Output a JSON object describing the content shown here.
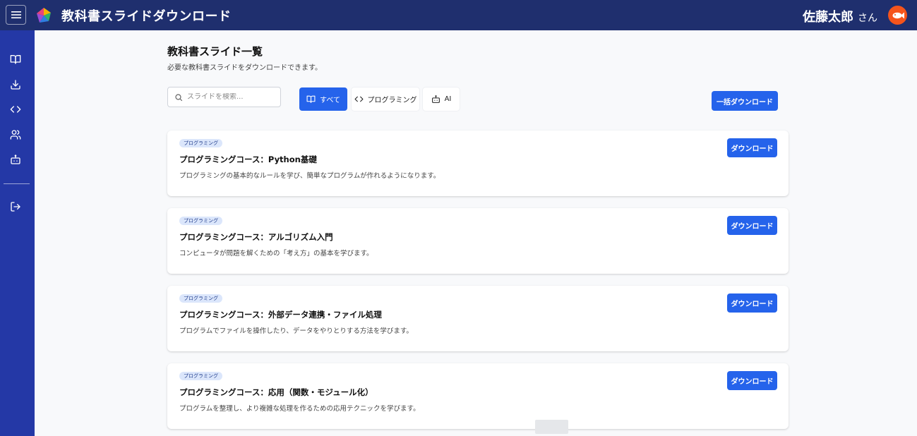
{
  "header": {
    "app_title": "教科書スライドダウンロード",
    "user_name": "佐藤太郎",
    "user_suffix": "さん",
    "menu_icon": "hamburger-menu-icon",
    "logo_icon": "gem-logo-icon",
    "avatar_icon": "fish-avatar-icon"
  },
  "sidebar": {
    "items": [
      {
        "icon": "book-icon",
        "label": "教科書"
      },
      {
        "icon": "download-icon",
        "label": "ダウンロード"
      },
      {
        "icon": "code-icon",
        "label": "プログラミング"
      },
      {
        "icon": "users-icon",
        "label": "ユーザー"
      },
      {
        "icon": "robot-icon",
        "label": "AI"
      }
    ],
    "logout_icon": "logout-icon"
  },
  "page": {
    "title": "教科書スライド一覧",
    "subtitle": "必要な教科書スライドをダウンロードできます。"
  },
  "search": {
    "placeholder": "スライドを検索...",
    "value": ""
  },
  "filters": [
    {
      "label": "すべて",
      "icon": "book-icon",
      "active": true
    },
    {
      "label": "プログラミング",
      "icon": "code-icon",
      "active": false
    },
    {
      "label": "AI",
      "icon": "robot-icon",
      "active": false
    }
  ],
  "bulk_download_label": "一括ダウンロード",
  "slides": [
    {
      "tag": "プログラミング",
      "title": "プログラミングコース：Python基礎",
      "description": "プログラミングの基本的なルールを学び、簡単なプログラムが作れるようになります。",
      "button": "ダウンロード"
    },
    {
      "tag": "プログラミング",
      "title": "プログラミングコース：アルゴリズム入門",
      "description": "コンピュータが問題を解くための「考え方」の基本を学びます。",
      "button": "ダウンロード"
    },
    {
      "tag": "プログラミング",
      "title": "プログラミングコース：外部データ連携・ファイル処理",
      "description": "プログラムでファイルを操作したり、データをやりとりする方法を学びます。",
      "button": "ダウンロード"
    },
    {
      "tag": "プログラミング",
      "title": "プログラミングコース：応用（関数・モジュール化）",
      "description": "プログラムを整理し、より複雑な処理を作るための応用テクニックを学びます。",
      "button": "ダウンロード"
    }
  ],
  "colors": {
    "topbar": "#1f2f6e",
    "sidebar": "#2438a6",
    "primary": "#2563eb",
    "tag_bg": "#dbe6fb",
    "avatar": "#f5541c"
  }
}
